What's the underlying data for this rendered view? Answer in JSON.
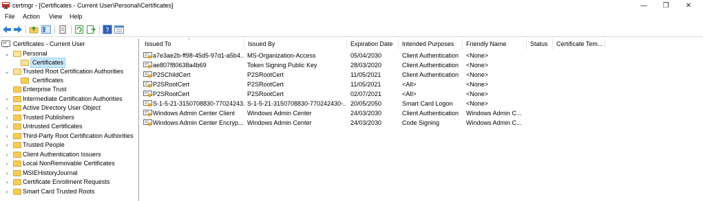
{
  "window": {
    "title": "certmgr - [Certificates - Current User\\Personal\\Certificates]",
    "minimize": "—",
    "maximize": "❐",
    "close": "✕"
  },
  "menu": [
    "File",
    "Action",
    "View",
    "Help"
  ],
  "toolbar": {
    "icons": [
      "back-icon",
      "forward-icon",
      "up-folder-icon",
      "show-hide-tree-icon",
      "delete-icon",
      "refresh-icon",
      "export-list-icon",
      "help-icon",
      "properties-icon"
    ]
  },
  "tree": {
    "root": "Certificates - Current User",
    "nodes": [
      {
        "label": "Personal",
        "expanded": true
      },
      {
        "label": "Certificates",
        "selected": true
      },
      {
        "label": "Trusted Root Certification Authorities",
        "expanded": true
      },
      {
        "label": "Certificates"
      },
      {
        "label": "Enterprise Trust"
      },
      {
        "label": "Intermediate Certification Authorities"
      },
      {
        "label": "Active Directory User Object"
      },
      {
        "label": "Trusted Publishers"
      },
      {
        "label": "Untrusted Certificates"
      },
      {
        "label": "Third-Party Root Certification Authorities"
      },
      {
        "label": "Trusted People"
      },
      {
        "label": "Client Authentication Issuers"
      },
      {
        "label": "Local NonRemovable Certificates"
      },
      {
        "label": "MSIEHistoryJournal"
      },
      {
        "label": "Certificate Enrollment Requests"
      },
      {
        "label": "Smart Card Trusted Roots"
      }
    ]
  },
  "columns": [
    "Issued To",
    "Issued By",
    "Expiration Date",
    "Intended Purposes",
    "Friendly Name",
    "Status",
    "Certificate Tem..."
  ],
  "rows": [
    [
      "a7e3ae2b-ff98-45d5-97d1-a5b4...",
      "MS-Organization-Access",
      "05/04/2030",
      "Client Authentication",
      "<None>",
      "",
      ""
    ],
    [
      "ae807f80638a4b69",
      "Token Signing Public Key",
      "28/03/2020",
      "Client Authentication",
      "<None>",
      "",
      ""
    ],
    [
      "P2SChildCert",
      "P2SRootCert",
      "11/05/2021",
      "Client Authentication",
      "<None>",
      "",
      ""
    ],
    [
      "P2SRootCert",
      "P2SRootCert",
      "11/05/2021",
      "<All>",
      "<None>",
      "",
      ""
    ],
    [
      "P2SRootCert",
      "P2SRootCert",
      "02/07/2021",
      "<All>",
      "<None>",
      "",
      ""
    ],
    [
      "S-1-5-21-3150708830-77024243...",
      "S-1-5-21-3150708830-770242430-...",
      "20/05/2050",
      "Smart Card Logon",
      "<None>",
      "",
      ""
    ],
    [
      "Windows Admin Center Client",
      "Windows Admin Center",
      "24/03/2030",
      "Client Authentication",
      "Windows Admin C...",
      "",
      ""
    ],
    [
      "Windows Admin Center Encryp...",
      "Windows Admin Center",
      "24/03/2030",
      "Code Signing",
      "Windows Admin C...",
      "",
      ""
    ]
  ],
  "colors": {
    "selection": "#cce8ff",
    "folder": "#f5cd57"
  }
}
